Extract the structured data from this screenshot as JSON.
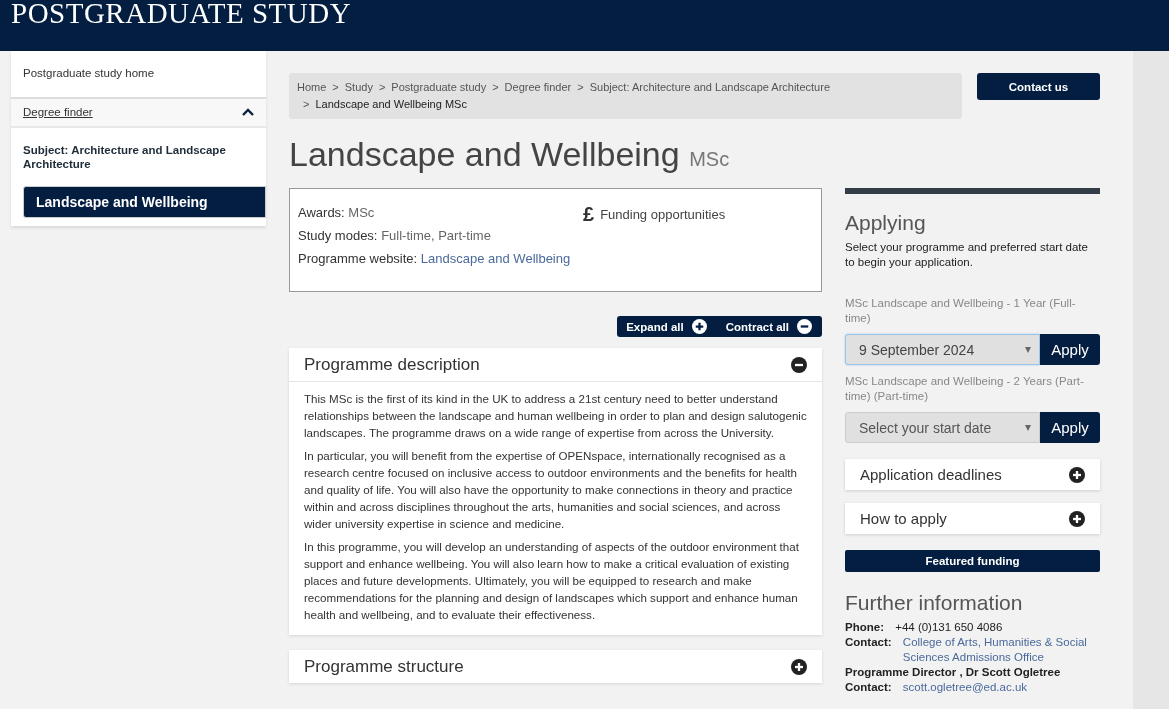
{
  "header": {
    "title": "POSTGRADUATE STUDY"
  },
  "sidebar": {
    "items": [
      {
        "label": "Postgraduate study home",
        "kind": "link",
        "selected": false
      },
      {
        "label": "Degree finder",
        "kind": "toggle",
        "selected": false,
        "expanded": true
      },
      {
        "label": "Subject: Architecture and Landscape Architecture",
        "kind": "heading",
        "selected": false
      },
      {
        "label": "Landscape and Wellbeing",
        "kind": "link",
        "selected": true
      }
    ]
  },
  "breadcrumb": [
    {
      "label": "Home",
      "current": false
    },
    {
      "sep": ">",
      "label": "Study",
      "current": false
    },
    {
      "sep": ">",
      "label": "Postgraduate study",
      "current": false
    },
    {
      "sep": ">",
      "label": "Degree finder",
      "current": false
    },
    {
      "sep": ">",
      "label": "Subject: Architecture and Landscape Architecture",
      "current": false
    },
    {
      "sep": ">",
      "label": "Landscape and Wellbeing MSc",
      "current": true
    }
  ],
  "contact_button": "Contact us",
  "title": {
    "name": "Landscape and Wellbeing",
    "award": "MSc"
  },
  "summary": {
    "facts": [
      {
        "label": "Awards:",
        "value": "MSc",
        "kind": "text"
      },
      {
        "label": "Study modes:",
        "value": "Full-time, Part-time",
        "kind": "text"
      },
      {
        "label": "Programme website:",
        "value": "Landscape and Wellbeing",
        "kind": "link"
      }
    ],
    "funding": {
      "icon": "£",
      "label": "Funding opportunities"
    }
  },
  "toolbar": {
    "expand_all": "Expand all",
    "contract_all": "Contract all"
  },
  "sections": [
    {
      "title": "Programme description",
      "expanded": true,
      "paragraphs": [
        "This MSc is the first of its kind in the UK to address a 21st century need to better understand relationships between the landscape and human wellbeing in order to plan and design salutogenic landscapes. The programme draws on a wide range of expertise from across the University.",
        "In particular, you will benefit from the expertise of OPENspace, internationally recognised as a research centre focused on inclusive access to outdoor environments and the benefits for health and quality of life. You will also have the opportunity to make connections in theory and practice within and across disciplines throughout the arts, humanities and social sciences, and across wider university expertise in science and medicine.",
        "In this programme, you will develop an understanding of aspects of the outdoor environment that support and enhance wellbeing. You will also learn how to make a critical evaluation of existing places and future developments. Ultimately, you will be equipped to research and make recommendations for the planning and design of landscapes which support and enhance human health and wellbeing, and to evaluate their effectiveness."
      ]
    },
    {
      "title": "Programme structure",
      "expanded": false
    }
  ],
  "applying": {
    "heading": "Applying",
    "intro": "Select your programme and preferred start date to begin your application.",
    "programmes": [
      {
        "label": "MSc Landscape and Wellbeing - 1 Year (Full-time)",
        "value": "9 September 2024",
        "focused": true,
        "button": "Apply"
      },
      {
        "label": "MSc Landscape and Wellbeing - 2 Years (Part-time) (Part-time)",
        "placeholder": "Select your start date",
        "focused": false,
        "button": "Apply"
      }
    ],
    "panels": [
      {
        "title": "Application deadlines",
        "expanded": false
      },
      {
        "title": "How to apply",
        "expanded": false
      }
    ],
    "featured": "Featured funding"
  },
  "further": {
    "heading": "Further information",
    "lines": [
      {
        "label": "Phone:",
        "value": "+44 (0)131 650 4086",
        "kind": "text"
      },
      {
        "label": "Contact:",
        "value": "College of Arts, Humanities & Social Sciences Admissions Office",
        "kind": "link"
      },
      {
        "value": "Programme Director , Dr Scott Ogletree",
        "kind": "bold"
      },
      {
        "label": "Contact:",
        "value": "scott.ogletree@ed.ac.uk",
        "kind": "link"
      }
    ]
  }
}
